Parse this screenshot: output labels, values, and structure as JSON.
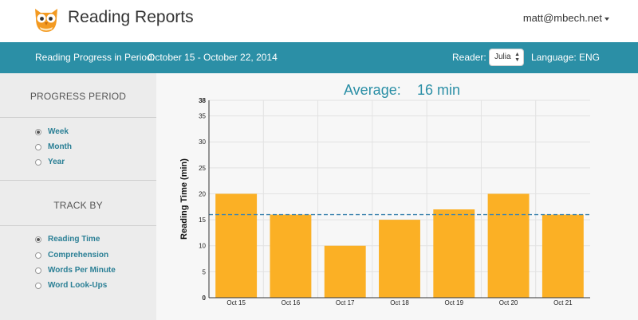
{
  "header": {
    "app_title": "Reading Reports",
    "user_email": "matt@mbech.net",
    "icons": {
      "logo": "owl-logo-icon",
      "user_caret": "caret-down-icon"
    }
  },
  "infobar": {
    "period_label": "Reading Progress in Period:",
    "period_range": "October 15 - October 22, 2014",
    "reader_label": "Reader:",
    "reader_value": "Julia",
    "language_label": "Language:",
    "language_value": "ENG"
  },
  "sidebar": {
    "period_heading": "PROGRESS PERIOD",
    "period_options": [
      {
        "label": "Week",
        "selected": true
      },
      {
        "label": "Month",
        "selected": false
      },
      {
        "label": "Year",
        "selected": false
      }
    ],
    "track_heading": "TRACK BY",
    "track_options": [
      {
        "label": "Reading Time",
        "selected": true
      },
      {
        "label": "Comprehension",
        "selected": false
      },
      {
        "label": "Words Per Minute",
        "selected": false
      },
      {
        "label": "Word Look-Ups",
        "selected": false
      }
    ]
  },
  "average": {
    "label": "Average:",
    "value": "16 min"
  },
  "colors": {
    "accent": "#2b8fa6",
    "bar": "#fbb025",
    "avg_line": "#3f86b0"
  },
  "chart_data": {
    "type": "bar",
    "categories": [
      "Oct 15",
      "Oct 16",
      "Oct 17",
      "Oct 18",
      "Oct 19",
      "Oct 20",
      "Oct 21"
    ],
    "values": [
      20,
      16,
      10,
      15,
      17,
      20,
      16
    ],
    "average": 16,
    "ylabel": "Reading Time (min)",
    "ylim": [
      0,
      38
    ],
    "yticks": [
      0,
      5,
      10,
      15,
      20,
      25,
      30,
      35,
      38
    ],
    "grid": true
  }
}
